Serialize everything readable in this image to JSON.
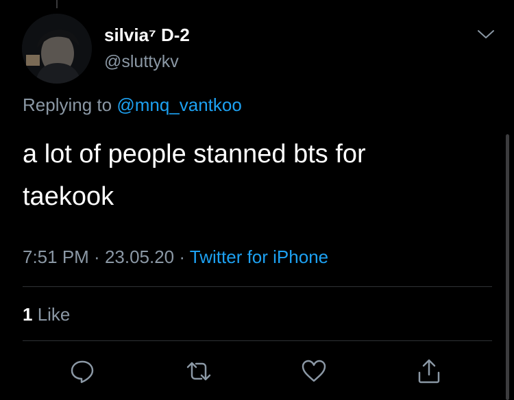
{
  "author": {
    "display_name": "silvia⁷ D-2",
    "handle": "@sluttykv"
  },
  "reply": {
    "prefix": "Replying to ",
    "mention": "@mnq_vantkoo"
  },
  "tweet": {
    "text": "a lot of people stanned bts for taekook"
  },
  "meta": {
    "time": "7:51 PM",
    "sep1": " · ",
    "date": "23.05.20",
    "sep2": " · ",
    "source": "Twitter for iPhone"
  },
  "stats": {
    "like_count": "1",
    "like_label": " Like"
  },
  "actions": [
    "reply-icon",
    "retweet-icon",
    "like-icon",
    "share-icon"
  ],
  "colors": {
    "background": "#000000",
    "text": "#ffffff",
    "secondary": "#8b98a5",
    "accent": "#1da1f2",
    "divider": "#2f3336"
  }
}
